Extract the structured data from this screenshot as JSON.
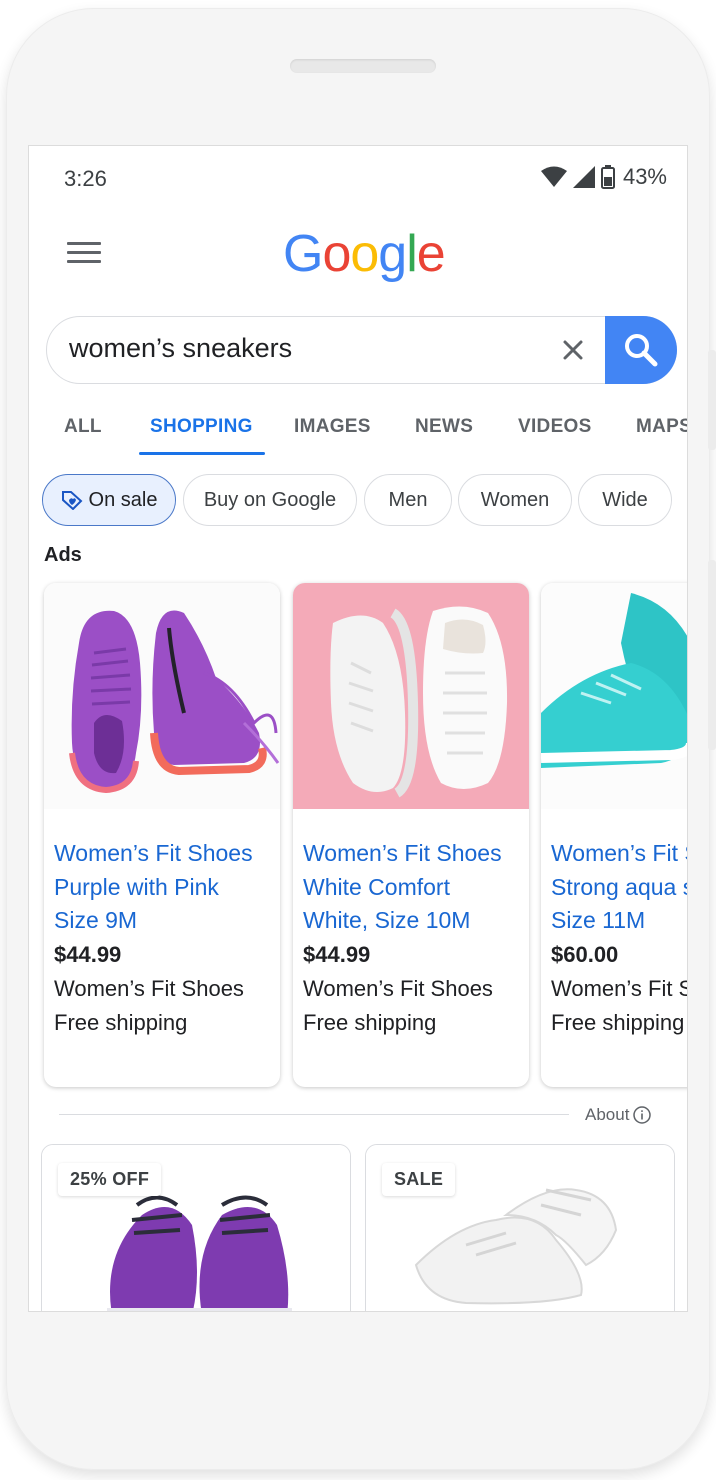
{
  "status_bar": {
    "time": "3:26",
    "battery": "43%"
  },
  "header": {
    "logo": [
      "G",
      "o",
      "o",
      "g",
      "l",
      "e"
    ]
  },
  "search": {
    "query": "women’s sneakers"
  },
  "tabs": [
    {
      "label": "ALL"
    },
    {
      "label": "SHOPPING",
      "active": true
    },
    {
      "label": "IMAGES"
    },
    {
      "label": "NEWS"
    },
    {
      "label": "VIDEOS"
    },
    {
      "label": "MAPS"
    }
  ],
  "chips": [
    {
      "label": "On sale",
      "active": true,
      "icon": "tag-icon"
    },
    {
      "label": "Buy on Google"
    },
    {
      "label": "Men"
    },
    {
      "label": "Women"
    },
    {
      "label": "Wide"
    }
  ],
  "ads_label": "Ads",
  "products": [
    {
      "title_lines": [
        "Women’s Fit Shoes",
        "Purple with Pink",
        "Size 9M"
      ],
      "price": "$44.99",
      "store": "Women’s Fit Shoes",
      "shipping": "Free shipping"
    },
    {
      "title_lines": [
        "Women’s Fit Shoes",
        "White Comfort",
        "White, Size 10M"
      ],
      "price": "$44.99",
      "store": "Women’s Fit Shoes",
      "shipping": "Free shipping"
    },
    {
      "title_lines": [
        "Women’s Fit Shoes",
        "Strong aqua shoes",
        "Size 11M"
      ],
      "price": "$60.00",
      "store": "Women’s Fit Shoes",
      "shipping": "Free shipping"
    }
  ],
  "about": "About",
  "tiles": [
    {
      "badge": "25% OFF"
    },
    {
      "badge": "SALE"
    }
  ],
  "colors": {
    "accent": "#1a73e8",
    "search_button": "#4285f4",
    "link": "#1967d2",
    "chip_active_bg": "#e8f0fe"
  }
}
